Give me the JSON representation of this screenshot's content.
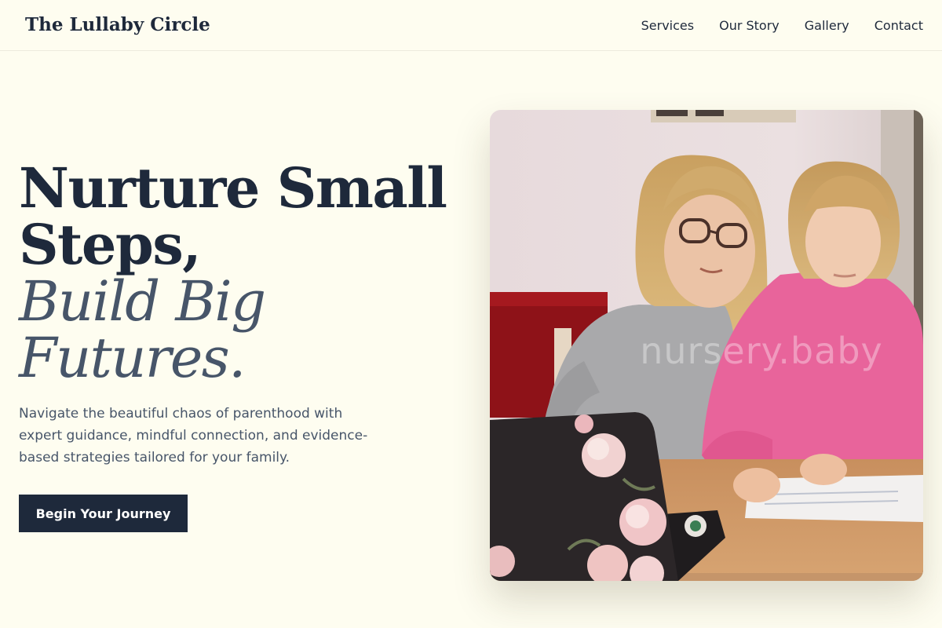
{
  "header": {
    "brand": "The Lullaby Circle",
    "nav": [
      {
        "label": "Services"
      },
      {
        "label": "Our Story"
      },
      {
        "label": "Gallery"
      },
      {
        "label": "Contact"
      }
    ]
  },
  "hero": {
    "title_line1": "Nurture Small",
    "title_line2": "Steps,",
    "title_line3": "Build Big",
    "title_line4": "Futures.",
    "description": "Navigate the beautiful chaos of parenthood with expert guidance, mindful connection, and evidence-based strategies tailored for your family.",
    "cta_label": "Begin Your Journey",
    "image_watermark": "nursery.baby"
  },
  "colors": {
    "background": "#FEFDF0",
    "primary": "#1E293B",
    "muted": "#475569"
  }
}
